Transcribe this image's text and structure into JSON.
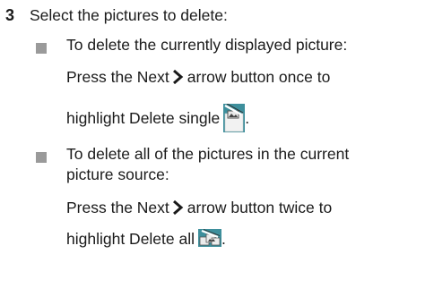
{
  "step": {
    "number": "3",
    "text": "Select the pictures to delete:"
  },
  "bullets": [
    {
      "heading": "To delete the currently displayed picture:",
      "line1_before": "Press the Next",
      "line1_after": "arrow button once to",
      "line2_text": "highlight Delete single",
      "line2_end": ".",
      "icon": "delete-single-icon"
    },
    {
      "heading_line1": "To delete all of the pictures in the current",
      "heading_line2": "picture source:",
      "line1_before": "Press the Next",
      "line1_after": "arrow button twice to",
      "line2_text": "highlight Delete all",
      "line2_end": ".",
      "icon": "delete-all-icon"
    }
  ],
  "icons": {
    "next_arrow": "chevron-right-icon"
  },
  "colors": {
    "text": "#1a1a1a",
    "bullet": "#9a9a9a",
    "icon_teal": "#3e8f9c"
  }
}
